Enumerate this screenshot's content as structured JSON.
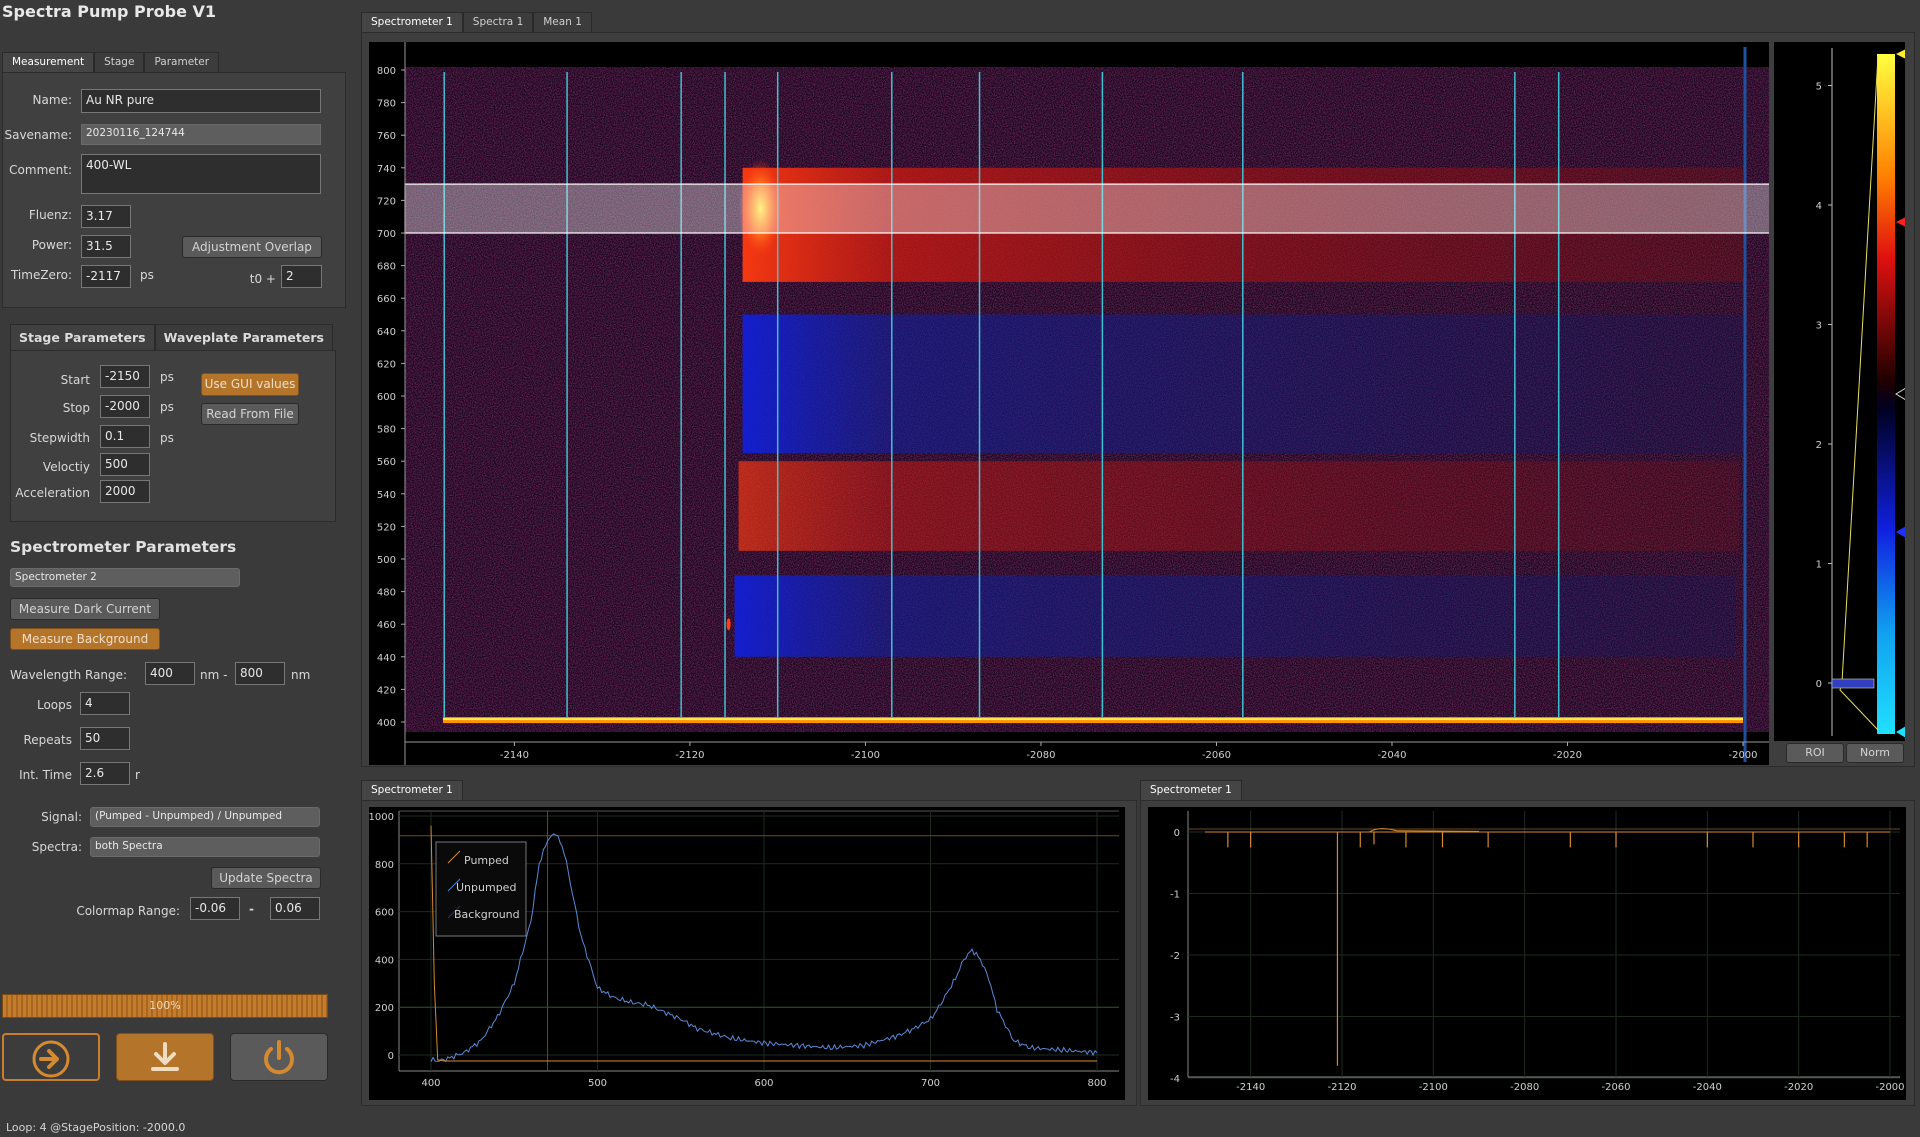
{
  "app": {
    "title": "Spectra Pump Probe V1"
  },
  "left": {
    "tabs": [
      "Measurement",
      "Stage",
      "Parameter"
    ],
    "measurement": {
      "name_label": "Name:",
      "name_value": "Au NR pure",
      "savename_label": "Savename:",
      "savename_value": "20230116_124744",
      "comment_label": "Comment:",
      "comment_value": "400-WL",
      "fluenz_label": "Fluenz:",
      "fluenz_value": "3.17",
      "power_label": "Power:",
      "power_value": "31.5",
      "adjust_button": "Adjustment Overlap",
      "timezero_label": "TimeZero:",
      "timezero_value": "-2117",
      "timezero_unit": "ps",
      "t0_label": "t0 +",
      "t0_value": "2"
    },
    "stage_tabs": [
      "Stage Parameters",
      "Waveplate Parameters"
    ],
    "stage": {
      "start_label": "Start",
      "start_value": "-2150",
      "start_unit": "ps",
      "stop_label": "Stop",
      "stop_value": "-2000",
      "stop_unit": "ps",
      "step_label": "Stepwidth",
      "step_value": "0.1",
      "step_unit": "ps",
      "vel_label": "Velоctiy",
      "vel_value": "500",
      "acc_label": "Acceleration",
      "acc_value": "2000",
      "use_gui_button": "Use GUI values",
      "read_file_button": "Read From File"
    },
    "spectrometer": {
      "title": "Spectrometer Parameters",
      "selected": "Spectrometer 2",
      "dark_button": "Measure Dark Current",
      "background_button": "Measure Background",
      "wl_label": "Wavelength Range:",
      "wl_min": "400",
      "wl_sep": "nm -",
      "wl_max": "800",
      "wl_unit": "nm",
      "loops_label": "Loops",
      "loops_value": "4",
      "repeats_label": "Repeats",
      "repeats_value": "50",
      "int_label": "Int. Time",
      "int_value": "2.6",
      "int_unit": "r",
      "signal_label": "Signal:",
      "signal_value": "(Pumped - Unpumped) / Unpumped",
      "spectra_label": "Spectra:",
      "spectra_value": "both Spectra",
      "update_button": "Update Spectra",
      "cmap_label": "Colormap Range:",
      "cmap_min": "-0.06",
      "cmap_sep": "-",
      "cmap_max": "0.06"
    },
    "progress": {
      "text": "100%",
      "value": 1.0
    },
    "status": "Loop: 4 @StagePosition: -2000.0"
  },
  "main": {
    "tabs": [
      "Spectrometer 1",
      "Spectra 1",
      "Mean  1"
    ],
    "heatmap": {
      "y_ticks": [
        "800",
        "780",
        "760",
        "740",
        "720",
        "700",
        "680",
        "660",
        "640",
        "620",
        "600",
        "580",
        "560",
        "540",
        "520",
        "500",
        "480",
        "460",
        "440",
        "420",
        "400"
      ],
      "x_ticks": [
        "-2140",
        "-2120",
        "-2100",
        "-2080",
        "-2060",
        "-2040",
        "-2020",
        "-2000"
      ],
      "colorbar_ticks": [
        "5",
        "4",
        "3",
        "2",
        "1",
        "0"
      ],
      "roi_button": "ROI",
      "norm_button": "Norm"
    },
    "spectra_plot": {
      "tab": "Spectrometer 1",
      "legend": [
        "Pumped",
        "Unpumped",
        "Background"
      ],
      "y_ticks": [
        "1000",
        "800",
        "600",
        "400",
        "200",
        "0"
      ],
      "x_ticks": [
        "400",
        "500",
        "600",
        "700",
        "800"
      ]
    },
    "kinetics_plot": {
      "tab": "Spectrometer 1",
      "y_ticks": [
        "0",
        "-1",
        "-2",
        "-3",
        "-4"
      ],
      "x_ticks": [
        "-2140",
        "-2120",
        "-2100",
        "-2080",
        "-2060",
        "-2040",
        "-2020",
        "-2000"
      ]
    }
  },
  "chart_data": [
    {
      "type": "heatmap",
      "title": "",
      "xlabel": "",
      "ylabel": "",
      "xlim": [
        -2150,
        -2000
      ],
      "ylim": [
        400,
        800
      ],
      "colorbar_range": [
        0,
        5.4
      ],
      "roi_wavelength_range": [
        700,
        730
      ],
      "vertical_markers": [
        -2148,
        -2134,
        -2121,
        -2116,
        -2110,
        -2097,
        -2087,
        -2073,
        -2057,
        -2026,
        -2021
      ]
    },
    {
      "type": "line",
      "xlabel": "",
      "ylabel": "",
      "xlim": [
        400,
        800
      ],
      "ylim": [
        -20,
        1000
      ],
      "series": [
        {
          "name": "Unpumped",
          "x": [
            400,
            405,
            410,
            420,
            430,
            440,
            450,
            460,
            465,
            470,
            475,
            480,
            490,
            500,
            510,
            520,
            530,
            540,
            550,
            560,
            570,
            580,
            600,
            620,
            640,
            660,
            680,
            690,
            700,
            705,
            710,
            715,
            720,
            725,
            730,
            735,
            740,
            750,
            760,
            780,
            800
          ],
          "y": [
            -20,
            -25,
            -15,
            10,
            60,
            160,
            300,
            560,
            800,
            900,
            930,
            850,
            500,
            280,
            240,
            220,
            210,
            180,
            150,
            110,
            90,
            70,
            50,
            40,
            30,
            40,
            80,
            110,
            150,
            200,
            260,
            320,
            400,
            440,
            400,
            320,
            190,
            60,
            30,
            20,
            10
          ]
        },
        {
          "name": "Pumped",
          "x": [
            400,
            402,
            404,
            408,
            800
          ],
          "y": [
            960,
            300,
            -20,
            -25,
            -25
          ]
        }
      ]
    },
    {
      "type": "line",
      "xlabel": "",
      "ylabel": "",
      "xlim": [
        -2150,
        -2000
      ],
      "ylim": [
        -4,
        0.2
      ],
      "series": [
        {
          "name": "",
          "x": [
            -2148,
            -2145,
            -2140,
            -2121,
            -2116,
            -2113,
            -2110,
            -2106,
            -2098,
            -2088,
            -2070,
            -2060,
            -2040,
            -2030,
            -2020,
            -2010,
            -2005,
            -2000
          ],
          "y": [
            0,
            -0.25,
            -0.25,
            -3.8,
            -0.25,
            -0.2,
            0.05,
            -0.25,
            -0.25,
            -0.25,
            -0.25,
            -0.25,
            -0.25,
            -0.25,
            -0.25,
            -0.25,
            -0.25,
            0
          ]
        }
      ]
    }
  ]
}
